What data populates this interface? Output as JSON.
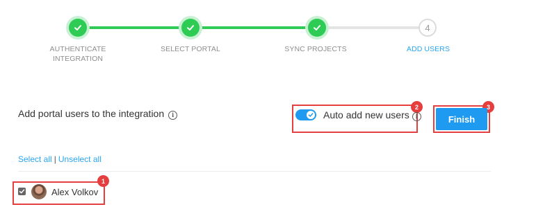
{
  "stepper": {
    "steps": [
      {
        "label": "AUTHENTICATE\nINTEGRATION",
        "status": "done",
        "icon": "check-icon"
      },
      {
        "label": "SELECT PORTAL",
        "status": "done",
        "icon": "check-icon"
      },
      {
        "label": "SYNC PROJECTS",
        "status": "done",
        "icon": "check-icon"
      },
      {
        "label": "ADD USERS",
        "status": "active",
        "number": "4"
      }
    ],
    "colors": {
      "done": "#2ecc55",
      "pending": "#dcdcdc",
      "active_label": "#2aa5f2"
    }
  },
  "main": {
    "title": "Add portal users to the integration",
    "title_info_icon": "i",
    "auto_add_label": "Auto add new users",
    "auto_add_enabled": true,
    "auto_add_info_icon": "i",
    "finish_label": "Finish",
    "select_all_label": "Select all",
    "separator": "|",
    "unselect_all_label": "Unselect all",
    "users": [
      {
        "name": "Alex Volkov",
        "checked": true
      }
    ]
  },
  "annotations": {
    "badge_1": "1",
    "badge_2": "2",
    "badge_3": "3",
    "color": "#e53e3e"
  },
  "colors": {
    "accent": "#1e9bf0",
    "link": "#2aa5f2"
  }
}
